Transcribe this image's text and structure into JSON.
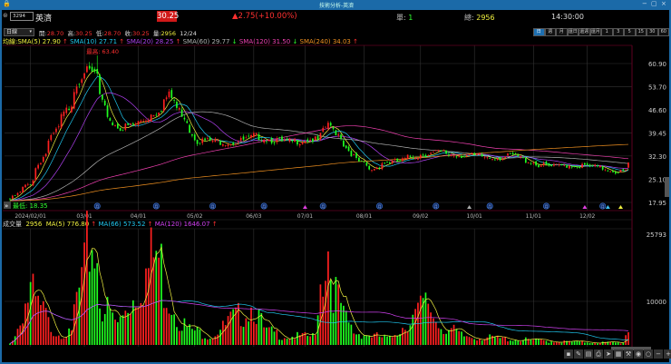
{
  "window": {
    "title": "技術分析-英濟",
    "controls": [
      "−",
      "▢",
      "×"
    ]
  },
  "quote": {
    "code": "3294",
    "name": "英濟",
    "price": "30.25",
    "change": "▲2.75(+10.00%)",
    "single_label": "單:",
    "single": "1",
    "total_label": "總:",
    "total": "2956",
    "time": "14:30:00"
  },
  "bar": {
    "period_select": "日線",
    "open_label": "開:",
    "open": "28.70",
    "high_label": "高:",
    "high": "30.25",
    "low_label": "低:",
    "low": "28.70",
    "close_label": "收:",
    "close": "30.25",
    "vol_label": "量:",
    "vol": "2956",
    "date": "12/24"
  },
  "periods": [
    {
      "label": "日",
      "active": true
    },
    {
      "label": "週"
    },
    {
      "label": "月"
    },
    {
      "label": "還日"
    },
    {
      "label": "還週"
    },
    {
      "label": "還月"
    },
    {
      "label": "1"
    },
    {
      "label": "3"
    },
    {
      "label": "5"
    },
    {
      "label": "15"
    },
    {
      "label": "30"
    },
    {
      "label": "60"
    }
  ],
  "ma_legend": {
    "prefix": "均線:",
    "items": [
      {
        "label": "SMA(5) 27.90",
        "arrow": "↑",
        "color": "#f0f040",
        "arrow_color": "#ff3030"
      },
      {
        "label": "SMA(10) 27.71",
        "arrow": "↑",
        "color": "#20c8f0",
        "arrow_color": "#ff3030"
      },
      {
        "label": "SMA(20) 28.25",
        "arrow": "↑",
        "color": "#b040f0",
        "arrow_color": "#ff3030"
      },
      {
        "label": "SMA(60) 29.77",
        "arrow": "↓",
        "color": "#b0b0b0",
        "arrow_color": "#30ff30"
      },
      {
        "label": "SMA(120) 31.50",
        "arrow": "↓",
        "color": "#f040b0",
        "arrow_color": "#30ff30"
      },
      {
        "label": "SMA(240) 34.03",
        "arrow": "↑",
        "color": "#f09020",
        "arrow_color": "#ff3030"
      }
    ]
  },
  "vol_legend": {
    "prefix": "成交量",
    "value": "2956",
    "items": [
      {
        "label": "MA(5) 776.80",
        "arrow": "↑",
        "color": "#f0f040"
      },
      {
        "label": "MA(66) 573.52",
        "arrow": "↑",
        "color": "#20c8f0"
      },
      {
        "label": "MA(120) 1646.07",
        "arrow": "↑",
        "color": "#d040f0"
      }
    ]
  },
  "colors": {
    "up": "#ff2020",
    "down": "#20ff20",
    "grid": "#333333",
    "axis": "#600020"
  },
  "chart_data": {
    "type": "candlestick",
    "price_axis": {
      "ticks": [
        "60.90",
        "53.70",
        "46.60",
        "39.45",
        "32.30",
        "25.10",
        "17.95"
      ],
      "range": [
        17.95,
        60.9
      ]
    },
    "date_ticks": [
      "2024/02/01",
      "03/01",
      "04/01",
      "05/02",
      "06/03",
      "07/01",
      "08/01",
      "09/02",
      "10/01",
      "11/01",
      "12/02"
    ],
    "max_label": "最高: 63.40",
    "min_label": "最低: 18.35",
    "close_keypoints": [
      [
        "2024-01-22",
        19
      ],
      [
        "2024-02-01",
        24
      ],
      [
        "2024-02-15",
        40
      ],
      [
        "2024-02-22",
        47.4
      ],
      [
        "2024-03-01",
        58.9
      ],
      [
        "2024-03-08",
        57.5
      ],
      [
        "2024-03-12",
        48.3
      ],
      [
        "2024-03-15",
        43.5
      ],
      [
        "2024-03-22",
        40.7
      ],
      [
        "2024-04-01",
        42.7
      ],
      [
        "2024-04-10",
        46
      ],
      [
        "2024-04-17",
        51
      ],
      [
        "2024-04-24",
        45.5
      ],
      [
        "2024-05-02",
        37.1
      ],
      [
        "2024-05-10",
        37
      ],
      [
        "2024-05-20",
        36.5
      ],
      [
        "2024-05-27",
        37
      ],
      [
        "2024-06-03",
        38.5
      ],
      [
        "2024-06-10",
        37.5
      ],
      [
        "2024-06-20",
        36.5
      ],
      [
        "2024-06-27",
        37
      ],
      [
        "2024-07-01",
        37.5
      ],
      [
        "2024-07-08",
        37.1
      ],
      [
        "2024-07-12",
        42.6
      ],
      [
        "2024-07-19",
        38.5
      ],
      [
        "2024-07-26",
        32.3
      ],
      [
        "2024-08-05",
        27.8
      ],
      [
        "2024-08-12",
        30.3
      ],
      [
        "2024-08-20",
        30.5
      ],
      [
        "2024-08-28",
        32.3
      ],
      [
        "2024-09-05",
        33
      ],
      [
        "2024-09-12",
        33.5
      ],
      [
        "2024-09-20",
        32.5
      ],
      [
        "2024-09-27",
        32.5
      ],
      [
        "2024-10-07",
        32
      ],
      [
        "2024-10-15",
        31.8
      ],
      [
        "2024-10-22",
        32.5
      ],
      [
        "2024-10-29",
        31
      ],
      [
        "2024-11-05",
        29.5
      ],
      [
        "2024-11-12",
        29
      ],
      [
        "2024-11-19",
        29.5
      ],
      [
        "2024-11-26",
        29.3
      ],
      [
        "2024-12-03",
        29
      ],
      [
        "2024-12-10",
        28.5
      ],
      [
        "2024-12-17",
        27.5
      ],
      [
        "2024-12-23",
        27.5
      ],
      [
        "2024-12-24",
        30.25
      ]
    ],
    "volume_axis": {
      "ticks": [
        "25793",
        "10000"
      ],
      "max": 25793
    },
    "volume_keypoints": [
      [
        "2024-01-22",
        300
      ],
      [
        "2024-02-01",
        12000
      ],
      [
        "2024-02-07",
        8000
      ],
      [
        "2024-02-15",
        3000
      ],
      [
        "2024-02-23",
        2500
      ],
      [
        "2024-03-01",
        16000
      ],
      [
        "2024-03-06",
        25000
      ],
      [
        "2024-03-12",
        9000
      ],
      [
        "2024-03-20",
        5000
      ],
      [
        "2024-04-10",
        21000
      ],
      [
        "2024-04-17",
        11000
      ],
      [
        "2024-04-26",
        4000
      ],
      [
        "2024-05-10",
        2000
      ],
      [
        "2024-06-03",
        10000
      ],
      [
        "2024-06-07",
        3500
      ],
      [
        "2024-06-20",
        2000
      ],
      [
        "2024-07-05",
        2000
      ],
      [
        "2024-07-12",
        24000
      ],
      [
        "2024-07-18",
        10000
      ],
      [
        "2024-07-26",
        3000
      ],
      [
        "2024-08-15",
        1500
      ],
      [
        "2024-09-05",
        9500
      ],
      [
        "2024-09-12",
        4500
      ],
      [
        "2024-09-25",
        2000
      ],
      [
        "2024-10-15",
        1500
      ],
      [
        "2024-11-15",
        800
      ],
      [
        "2024-12-20",
        500
      ],
      [
        "2024-12-24",
        2956
      ]
    ],
    "event_icons": {
      "glyph": "月",
      "dates": [
        "2024-03-08",
        "2024-04-10",
        "2024-05-10",
        "2024-06-07",
        "2024-07-10",
        "2024-08-09",
        "2024-09-10",
        "2024-10-09",
        "2024-11-08",
        "2024-12-10"
      ]
    },
    "triangle_markers": [
      {
        "date": "2024-07-01",
        "color": "#e040e0"
      },
      {
        "date": "2024-09-27",
        "color": "#aaaaaa"
      },
      {
        "date": "2024-11-29",
        "color": "#e040e0"
      },
      {
        "date": "2024-12-12",
        "color": "#40c0f0"
      },
      {
        "date": "2024-12-19",
        "color": "#f0f040"
      }
    ]
  },
  "toolbar": {
    "icons": [
      "▪",
      "✎",
      "▤",
      "⎙",
      "➤",
      "▦",
      "⚒",
      "◉",
      "○",
      "−",
      "+"
    ]
  }
}
